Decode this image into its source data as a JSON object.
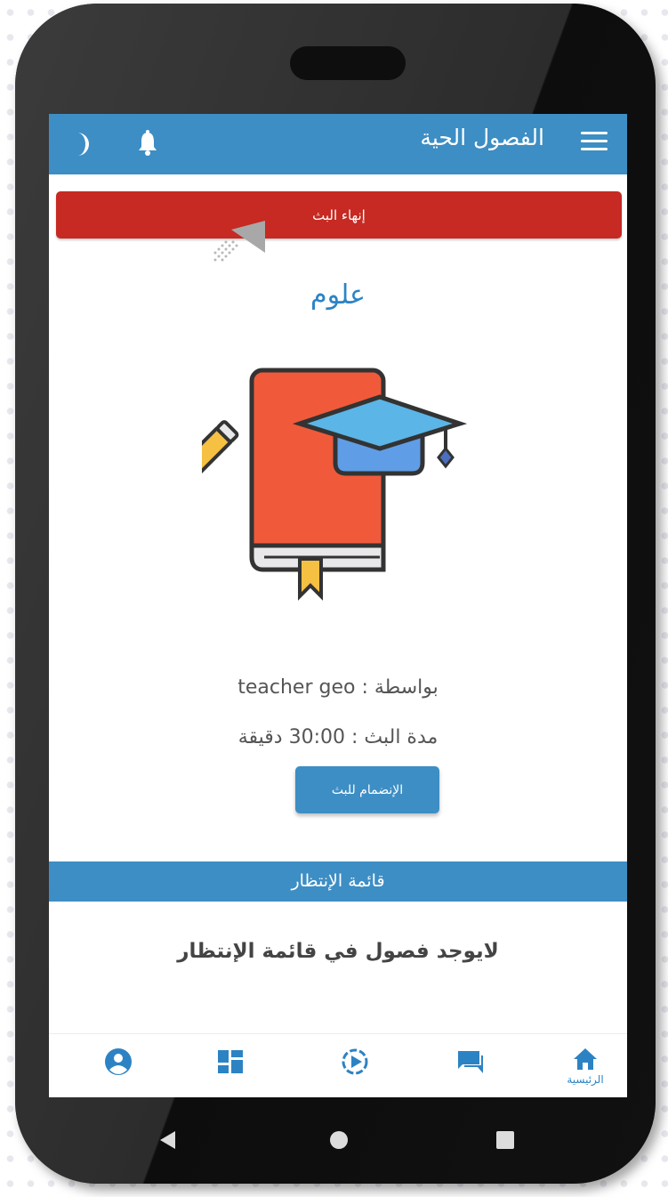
{
  "app_bar": {
    "title": "الفصول الحية",
    "menu_icon": "hamburger-icon",
    "notification_icon": "bell-icon",
    "theme_icon": "moon-icon"
  },
  "stream": {
    "end_button_label": "إنهاء البث",
    "subject": "علوم",
    "by_line": "بواسطة : teacher geo",
    "duration_line": "مدة البث : 30:00 دقيقة",
    "join_button_label": "الإنضمام للبث",
    "illustration": "book-graduation-cap-icon"
  },
  "queue": {
    "header": "قائمة الإنتظار",
    "empty_message": "لايوجد فصول في قائمة الإنتظار"
  },
  "bottom_nav": {
    "items": [
      {
        "icon": "home-icon",
        "label": "الرئيسية",
        "active": true
      },
      {
        "icon": "chat-icon",
        "label": "",
        "active": false
      },
      {
        "icon": "play-circle-icon",
        "label": "",
        "active": false
      },
      {
        "icon": "dashboard-icon",
        "label": "",
        "active": false
      },
      {
        "icon": "account-icon",
        "label": "",
        "active": false
      }
    ]
  },
  "colors": {
    "primary": "#3d8ec4",
    "danger": "#c62a22",
    "subject_text": "#2c83c4"
  }
}
